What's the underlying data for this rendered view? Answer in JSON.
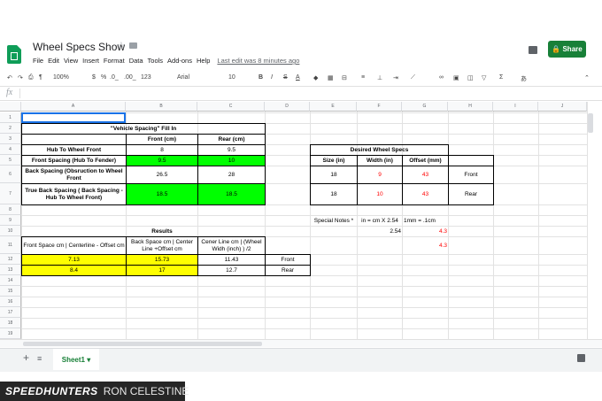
{
  "doc": {
    "title": "Wheel Specs Show",
    "menu": [
      "File",
      "Edit",
      "View",
      "Insert",
      "Format",
      "Data",
      "Tools",
      "Add-ons",
      "Help"
    ],
    "last_edit": "Last edit was 8 minutes ago",
    "share": "Share"
  },
  "toolbar": {
    "zoom": "100%",
    "currency": "$",
    "percent": "%",
    "dec_less": ".0_",
    "dec_more": ".00_",
    "format": "123",
    "font": "Arial",
    "size": "10",
    "bold": "B",
    "italic": "I",
    "strike": "S",
    "textcolor": "A"
  },
  "fx": "fx",
  "columns": [
    "A",
    "B",
    "C",
    "D",
    "E",
    "F",
    "G",
    "H",
    "I",
    "J"
  ],
  "rows": [
    "1",
    "2",
    "3",
    "4",
    "5",
    "6",
    "7",
    "8",
    "9",
    "10",
    "11",
    "12",
    "13",
    "14",
    "15",
    "16",
    "17",
    "18",
    "19"
  ],
  "cells": {
    "vehicle_title": "\"Vehicle Spacing\" Fill In",
    "front_cm": "Front (cm)",
    "rear_cm": "Rear (cm)",
    "hub_label": "Hub To Wheel Front",
    "hub_front": "8",
    "hub_rear": "9.5",
    "fs_label": "Front Spacing (Hub To Fender)",
    "fs_front": "9.5",
    "fs_rear": "10",
    "bs_label": "Back Spacing (Obsruction to Wheel Front",
    "bs_front": "26.5",
    "bs_rear": "28",
    "tbs_label": "True Back Spacing ( Back Spacing - Hub To Wheel Front)",
    "tbs_front": "18.5",
    "tbs_rear": "18.5",
    "desired_title": "Desired Wheel Specs",
    "size_h": "Size (in)",
    "width_h": "Width (in)",
    "offset_h": "Offset (mm)",
    "d1_size": "18",
    "d1_width": "9",
    "d1_offset": "43",
    "d1_pos": "Front",
    "d2_size": "18",
    "d2_width": "10",
    "d2_offset": "43",
    "d2_pos": "Rear",
    "notes": "Special Notes *",
    "notes2": "in = cm X 2.54",
    "notes3": "1mm = .1cm",
    "r10_f": "2.54",
    "r10_g": "4.3",
    "r11_g": "4.3",
    "results": "Results",
    "res_a": "Front Space cm | Centerline - Offset cm",
    "res_b": "Back Space cm | Center Line +Offset cm",
    "res_c": "Cener Line cm | (Wheel Widh (inch) ) /2",
    "r12_a": "7.13",
    "r12_b": "15.73",
    "r12_c": "11.43",
    "r12_d": "Front",
    "r13_a": "8.4",
    "r13_b": "17",
    "r13_c": "12.7",
    "r13_d": "Rear"
  },
  "sheet": "Sheet1",
  "watermark": {
    "brand": "SPEEDHUNTERS",
    "author": "RON CELESTINE"
  },
  "colors": {
    "green": "#00ff00",
    "yellow": "#ffff00",
    "red": "#ff0000",
    "share": "#188038"
  }
}
